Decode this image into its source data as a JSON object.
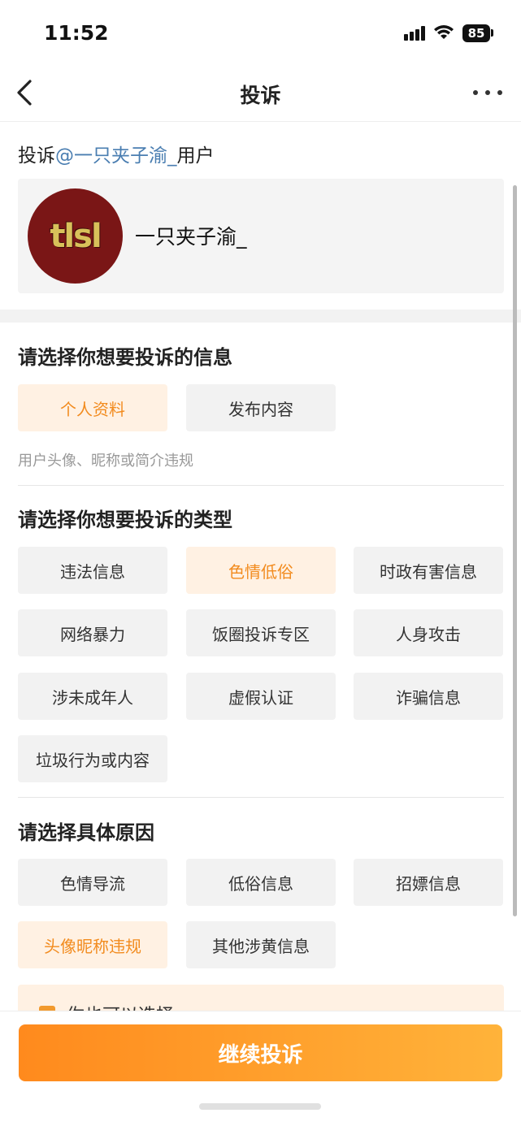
{
  "status_bar": {
    "time": "11:52",
    "battery": "85"
  },
  "nav": {
    "title": "投诉"
  },
  "target": {
    "prefix": "投诉",
    "mention": "@一只夹子渝_",
    "suffix": "用户"
  },
  "user_card": {
    "avatar_text": "tlsl",
    "name": "一只夹子渝_"
  },
  "info_section": {
    "title": "请选择你想要投诉的信息",
    "options": [
      {
        "label": "个人资料",
        "selected": true
      },
      {
        "label": "发布内容",
        "selected": false
      }
    ],
    "hint": "用户头像、昵称或简介违规"
  },
  "type_section": {
    "title": "请选择你想要投诉的类型",
    "options": [
      {
        "label": "违法信息",
        "selected": false
      },
      {
        "label": "色情低俗",
        "selected": true
      },
      {
        "label": "时政有害信息",
        "selected": false
      },
      {
        "label": "网络暴力",
        "selected": false
      },
      {
        "label": "饭圈投诉专区",
        "selected": false
      },
      {
        "label": "人身攻击",
        "selected": false
      },
      {
        "label": "涉未成年人",
        "selected": false
      },
      {
        "label": "虚假认证",
        "selected": false
      },
      {
        "label": "诈骗信息",
        "selected": false
      },
      {
        "label": "垃圾行为或内容",
        "selected": false
      }
    ]
  },
  "reason_section": {
    "title": "请选择具体原因",
    "options": [
      {
        "label": "色情导流",
        "selected": false
      },
      {
        "label": "低俗信息",
        "selected": false
      },
      {
        "label": "招嫖信息",
        "selected": false
      },
      {
        "label": "头像昵称违规",
        "selected": true
      },
      {
        "label": "其他涉黄信息",
        "selected": false
      }
    ]
  },
  "notice": {
    "text": "你也可以选择"
  },
  "footer": {
    "submit_label": "继续投诉"
  },
  "colors": {
    "accent": "#f28b1e",
    "chip_selected_bg": "#fff1e3",
    "chip_bg": "#f2f2f2",
    "mention": "#4a7eb1"
  },
  "icons": [
    "back-arrow-icon",
    "more-dots-icon",
    "signal-icon",
    "wifi-icon",
    "battery-icon",
    "checkbox-icon"
  ]
}
